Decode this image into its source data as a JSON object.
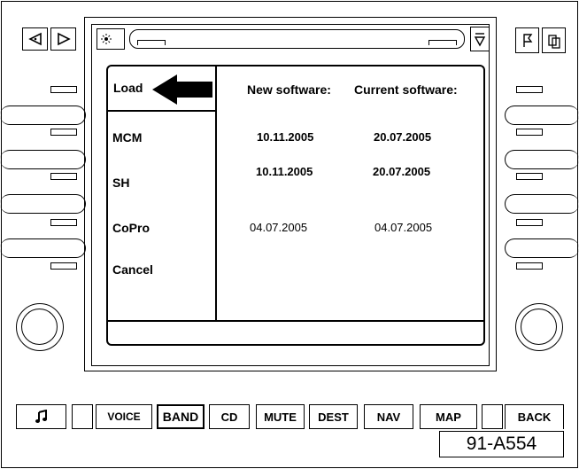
{
  "screen": {
    "menu": {
      "load": "Load",
      "mcm": "MCM",
      "sh": "SH",
      "copro": "CoPro",
      "cancel": "Cancel"
    },
    "headers": {
      "new": "New software:",
      "current": "Current software:"
    },
    "rows": [
      {
        "new": "10.11.2005",
        "current": "20.07.2005"
      },
      {
        "new": "10.11.2005",
        "current": "20.07.2005"
      },
      {
        "new": "04.07.2005",
        "current": "04.07.2005"
      }
    ]
  },
  "bottom_buttons": {
    "voice": "VOICE",
    "band": "BAND",
    "cd": "CD",
    "mute": "MUTE",
    "dest": "DEST",
    "nav": "NAV",
    "map": "MAP",
    "back": "BACK"
  },
  "figure_code": "91-A554"
}
